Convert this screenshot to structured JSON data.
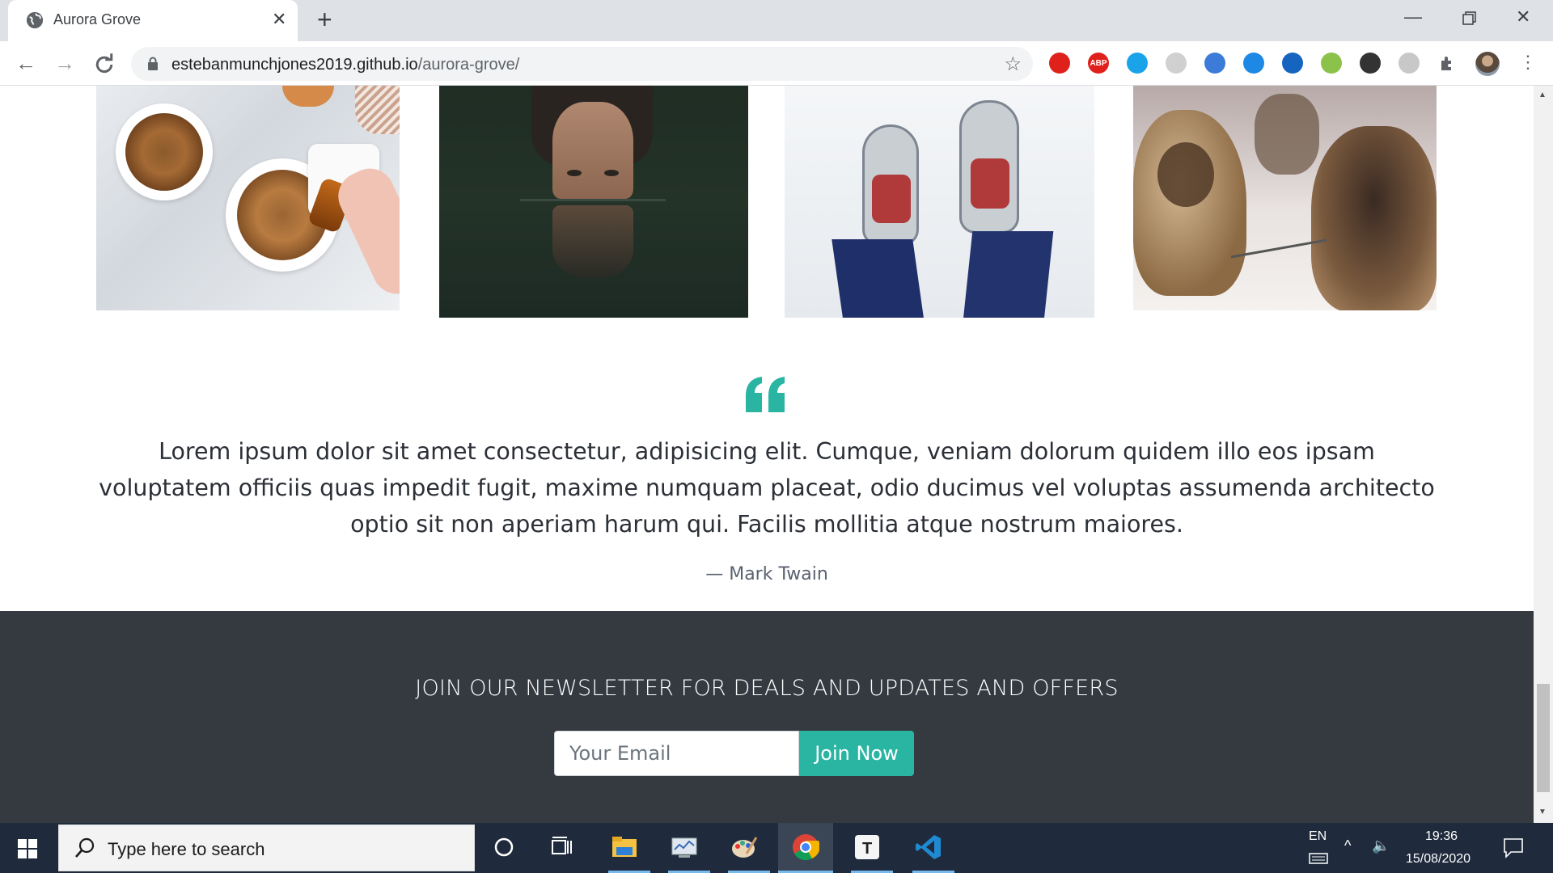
{
  "browser": {
    "tab_title": "Aurora Grove",
    "url_host": "estebanmunchjones2019.github.io",
    "url_path": "/aurora-grove/",
    "extensions": [
      {
        "name": "opera-vpn-icon",
        "color": "#e0201a",
        "label": ""
      },
      {
        "name": "adblock-plus-icon",
        "color": "#e0201a",
        "label": "ABP"
      },
      {
        "name": "tab-sync-icon",
        "color": "#1aa3e8",
        "label": ""
      },
      {
        "name": "grid-extension-icon",
        "color": "#d0d0d0",
        "label": ""
      },
      {
        "name": "moon-extension-icon",
        "color": "#3d7bd8",
        "label": ""
      },
      {
        "name": "window-blocker-icon",
        "color": "#1e88e5",
        "label": ""
      },
      {
        "name": "crop-extension-icon",
        "color": "#1565c0",
        "label": ""
      },
      {
        "name": "pin-extension-icon",
        "color": "#8bc34a",
        "label": ""
      },
      {
        "name": "dark-mode-icon",
        "color": "#333333",
        "label": ""
      },
      {
        "name": "record-extension-icon",
        "color": "#c8c8c8",
        "label": ""
      }
    ]
  },
  "quote": {
    "text": "Lorem ipsum dolor sit amet consectetur, adipisicing elit. Cumque, veniam dolorum quidem illo eos ipsam voluptatem officiis quas impedit fugit, maxime numquam placeat, odio ducimus vel voluptas assumenda architecto optio sit non aperiam harum qui. Facilis mollitia atque nostrum maiores.",
    "author": "— Mark Twain",
    "accent_color": "#2ab5a3"
  },
  "newsletter": {
    "title": "JOIN OUR NEWSLETTER FOR DEALS AND UPDATES AND OFFERS",
    "email_placeholder": "Your Email",
    "button_label": "Join Now"
  },
  "taskbar": {
    "search_placeholder": "Type here to search",
    "language": "EN",
    "time": "19:36",
    "date": "15/08/2020"
  }
}
